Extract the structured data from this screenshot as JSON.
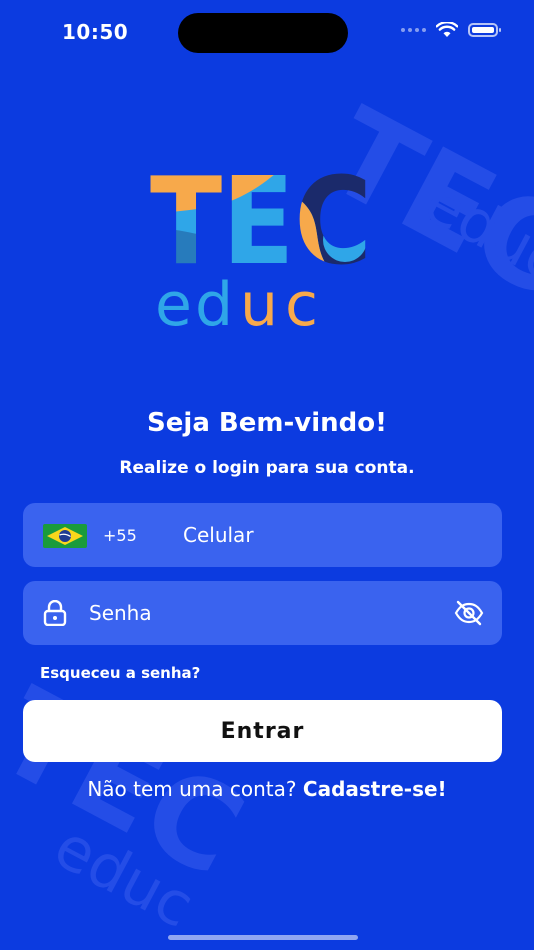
{
  "status_bar": {
    "time": "10:50"
  },
  "logo": {
    "line1": "TEC",
    "line2": "educ"
  },
  "welcome": {
    "title": "Seja Bem-vindo!",
    "subtitle": "Realize o login para sua conta."
  },
  "phone": {
    "country_flag": "brazil-flag-icon",
    "country_code": "+55",
    "placeholder": "Celular"
  },
  "password": {
    "placeholder": "Senha",
    "left_icon": "lock-icon",
    "right_icon": "eye-off-icon"
  },
  "forgot_password": "Esqueceu a senha?",
  "enter_button": "Entrar",
  "signup": {
    "question": "Não tem uma conta?",
    "link": "Cadastre-se!"
  },
  "colors": {
    "background": "#0C3BE0",
    "field": "#3A63EF",
    "button": "#FFFFFF",
    "logo_orange": "#F7A94B",
    "logo_cyan": "#2FA6E8",
    "logo_navy": "#1B2A6B"
  }
}
